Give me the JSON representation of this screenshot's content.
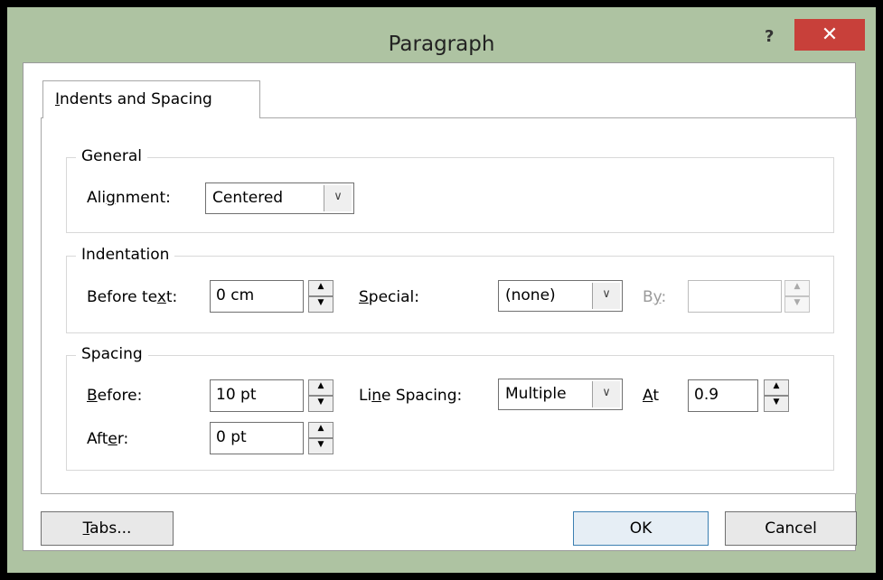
{
  "window": {
    "title": "Paragraph",
    "help_label": "?",
    "close_label": "✕"
  },
  "tabs": [
    {
      "label": "Indents and Spacing",
      "mnemonic_before": "",
      "mnemonic": "I",
      "mnemonic_after": "ndents and Spacing"
    }
  ],
  "general": {
    "title": "General",
    "alignment": {
      "label_pre": "Ali",
      "label_mn": "g",
      "label_post": "nment:",
      "value": "Centered"
    }
  },
  "indentation": {
    "title": "Indentation",
    "before_text": {
      "label_pre": "Before te",
      "label_mn": "x",
      "label_post": "t:",
      "value": "0 cm"
    },
    "special": {
      "label_pre": "",
      "label_mn": "S",
      "label_post": "pecial:",
      "value": "(none)"
    },
    "by": {
      "label_pre": "B",
      "label_mn": "y",
      "label_post": ":",
      "value": ""
    }
  },
  "spacing": {
    "title": "Spacing",
    "before": {
      "label_pre": "",
      "label_mn": "B",
      "label_post": "efore:",
      "value": "10 pt"
    },
    "after": {
      "label_pre": "Aft",
      "label_mn": "e",
      "label_post": "r:",
      "value": "0 pt"
    },
    "line_spacing": {
      "label_pre": "Li",
      "label_mn": "n",
      "label_post": "e Spacing:",
      "value": "Multiple"
    },
    "at": {
      "label_pre": "",
      "label_mn": "A",
      "label_post": "t",
      "value": "0.9"
    }
  },
  "buttons": {
    "tabs": {
      "pre": "",
      "mn": "T",
      "post": "abs..."
    },
    "ok": "OK",
    "cancel": "Cancel"
  },
  "icons": {
    "dropdown": "chevron-down-icon",
    "spin_up": "triangle-up-icon",
    "spin_down": "triangle-down-icon"
  }
}
